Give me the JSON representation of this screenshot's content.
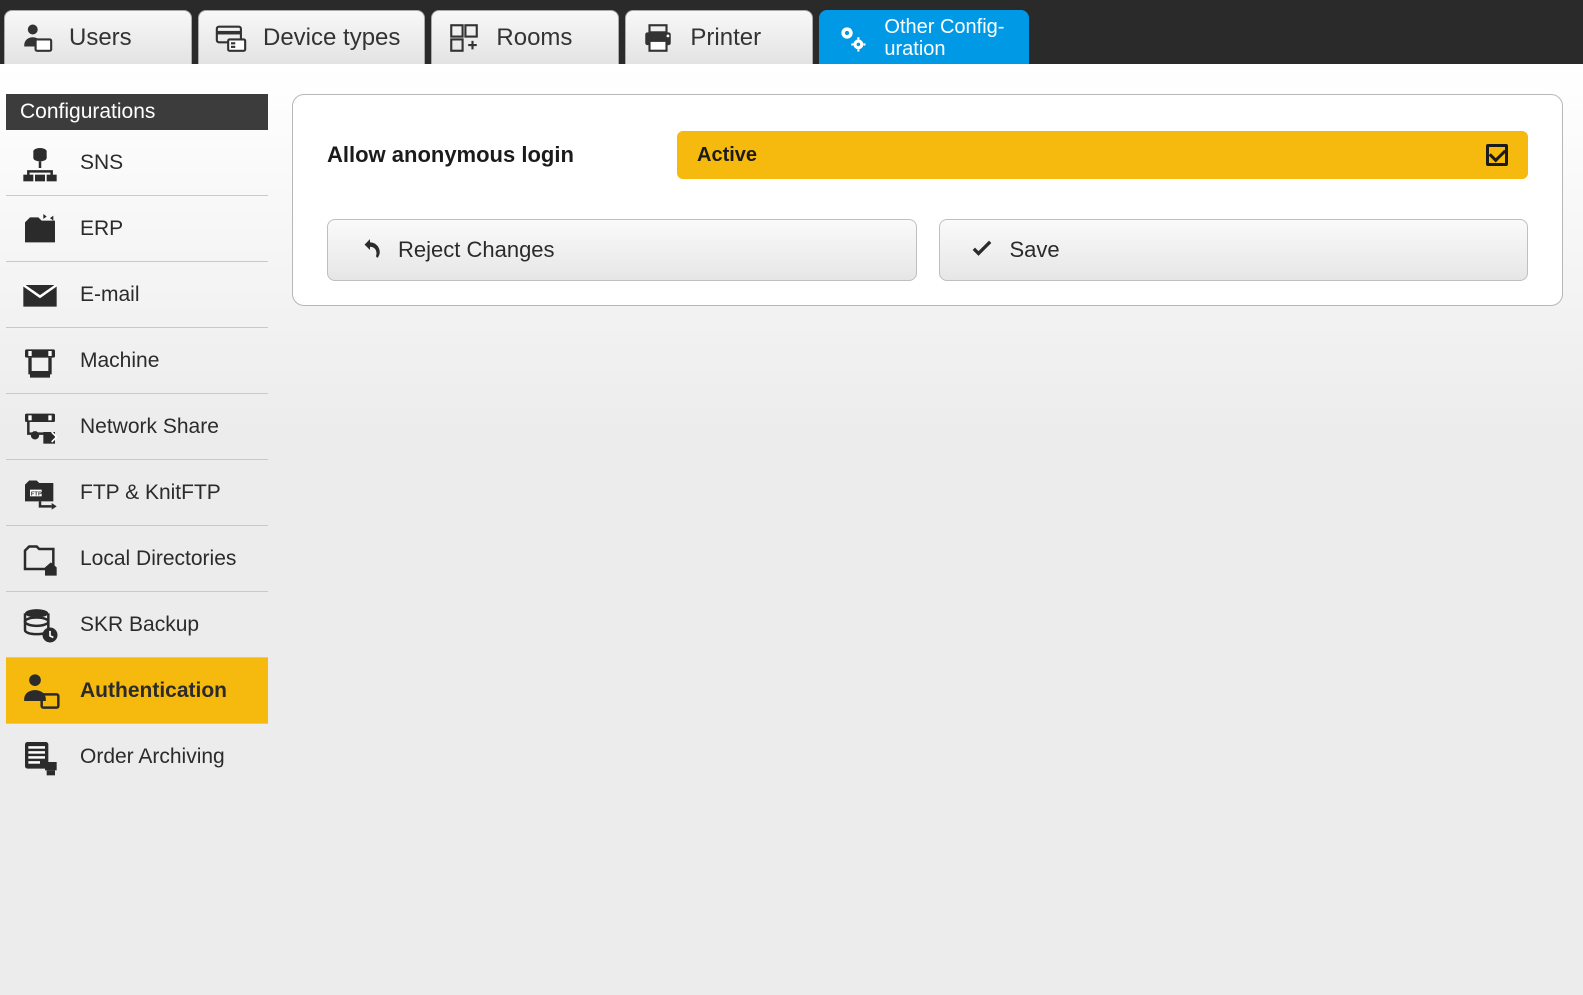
{
  "tabs": [
    {
      "id": "users",
      "label": "Users"
    },
    {
      "id": "device-types",
      "label": "Device types"
    },
    {
      "id": "rooms",
      "label": "Rooms"
    },
    {
      "id": "printer",
      "label": "Printer"
    },
    {
      "id": "other-config",
      "label_line1": "Other Config-",
      "label_line2": "uration",
      "active": true
    }
  ],
  "sidebar": {
    "header": "Configurations",
    "items": [
      {
        "id": "sns",
        "label": "SNS"
      },
      {
        "id": "erp",
        "label": "ERP"
      },
      {
        "id": "email",
        "label": "E-mail"
      },
      {
        "id": "machine",
        "label": "Machine"
      },
      {
        "id": "netshare",
        "label": "Network Share"
      },
      {
        "id": "ftp",
        "label": "FTP & KnitFTP"
      },
      {
        "id": "localdir",
        "label": "Local Directories"
      },
      {
        "id": "skrbackup",
        "label": "SKR Backup"
      },
      {
        "id": "auth",
        "label": "Authentication",
        "active": true
      },
      {
        "id": "archiving",
        "label": "Order Archiving"
      }
    ]
  },
  "panel": {
    "setting_label": "Allow anonymous login",
    "toggle_state": "Active",
    "reject_label": "Reject Changes",
    "save_label": "Save"
  }
}
